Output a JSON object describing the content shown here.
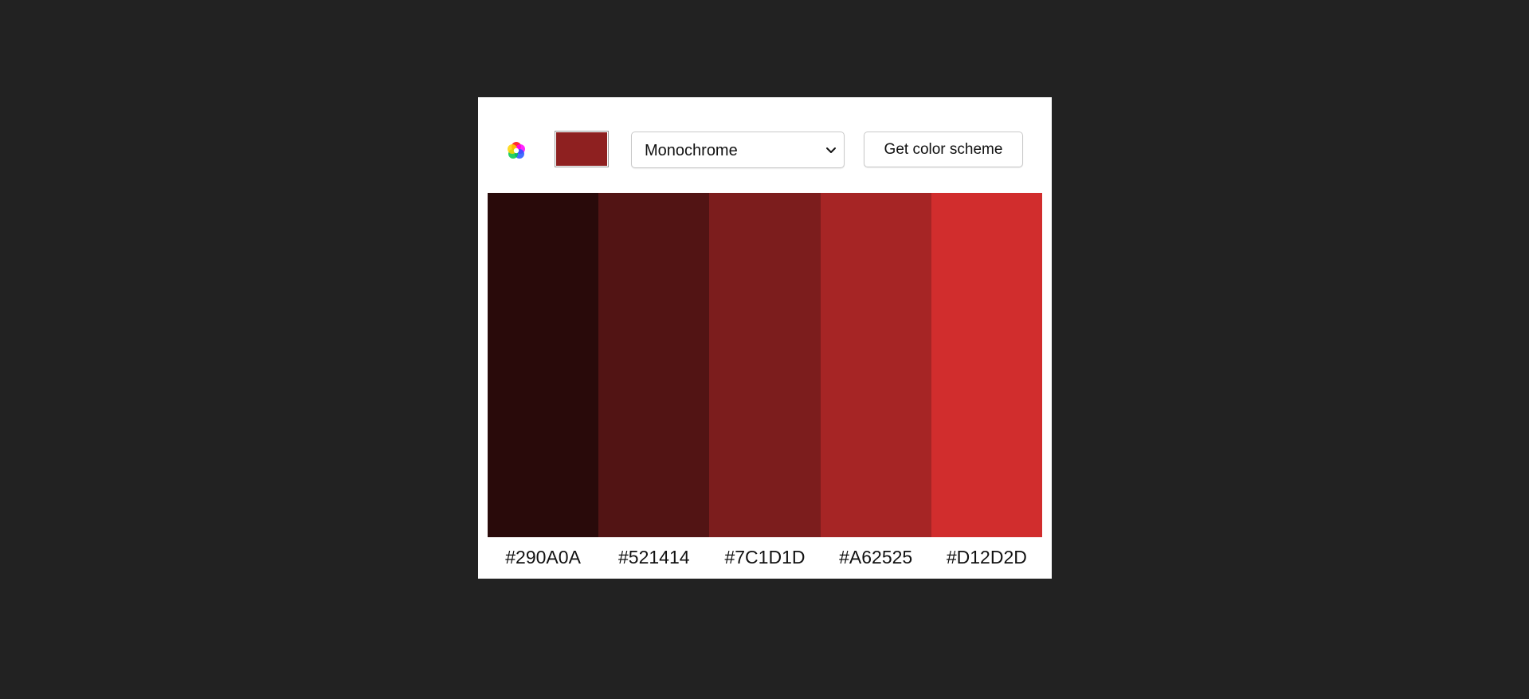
{
  "toolbar": {
    "logo_icon": "color-wheel-icon",
    "seed_color": "#8E2020",
    "mode_select": {
      "selected": "Monochrome",
      "icon": "chevron-down-icon"
    },
    "submit_label": "Get color scheme"
  },
  "palette": {
    "colors": [
      {
        "hex": "#290A0A",
        "label": "#290A0A"
      },
      {
        "hex": "#521414",
        "label": "#521414"
      },
      {
        "hex": "#7C1D1D",
        "label": "#7C1D1D"
      },
      {
        "hex": "#A62525",
        "label": "#A62525"
      },
      {
        "hex": "#D12D2D",
        "label": "#D12D2D"
      }
    ]
  }
}
